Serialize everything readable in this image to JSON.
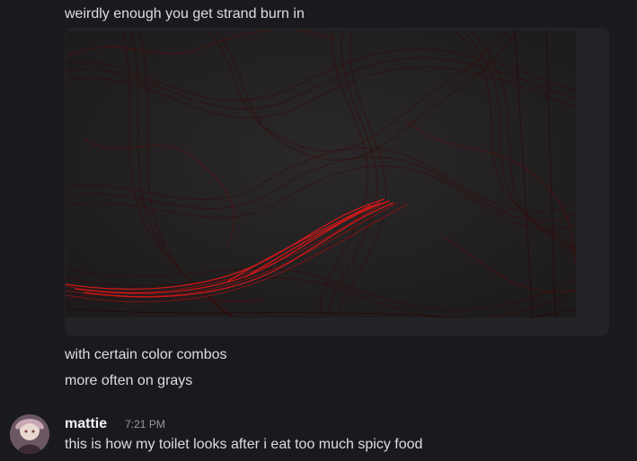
{
  "messages": {
    "line1": "weirdly enough you get strand burn in",
    "line2": "with certain color combos",
    "line3": "more often on grays",
    "post": {
      "username": "mattie",
      "timestamp": "7:21 PM",
      "text": "this is how my toilet looks after i eat too much spicy food"
    }
  },
  "attachment": {
    "kind": "image",
    "subject": "dark gray canvas with flowing dark red strands and a bright red burn-in streak"
  },
  "colors": {
    "background": "#1a1a1e",
    "text": "#dbdee1",
    "username": "#f2f3f5",
    "timestamp": "#949ba4",
    "strand_dark": "#5a0a0a",
    "strand_bright": "#e01818"
  }
}
